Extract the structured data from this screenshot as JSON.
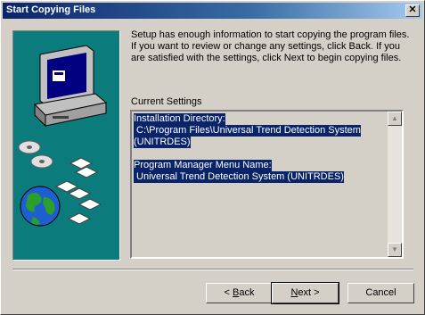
{
  "window": {
    "title": "Start Copying Files",
    "close_glyph": "✕"
  },
  "intro_text": "Setup has enough information to start copying the program files. If you want to review or change any settings, click Back. If you are satisfied with the settings, click Next to begin copying files.",
  "current_settings": {
    "label": "Current Settings",
    "lines": [
      "Installation Directory:",
      " C:\\Program Files\\Universal Trend Detection System",
      "(UNITRDES)",
      "",
      "Program Manager Menu Name:",
      " Universal Trend Detection System (UNITRDES)"
    ]
  },
  "scrollbar": {
    "up_icon": "▲",
    "down_icon": "▼"
  },
  "buttons": {
    "back": {
      "mnemonic": "B",
      "rest": "ack",
      "prefix": "< "
    },
    "next": {
      "mnemonic": "N",
      "rest": "ext",
      "suffix": " >"
    },
    "cancel": "Cancel"
  },
  "colors": {
    "title_start": "#0a246a",
    "art_background": "#0c7b7b",
    "selection": "#0a246a"
  },
  "icons": [
    "computer-icon",
    "cd-icon",
    "floppy-disk-icon",
    "globe-icon"
  ]
}
